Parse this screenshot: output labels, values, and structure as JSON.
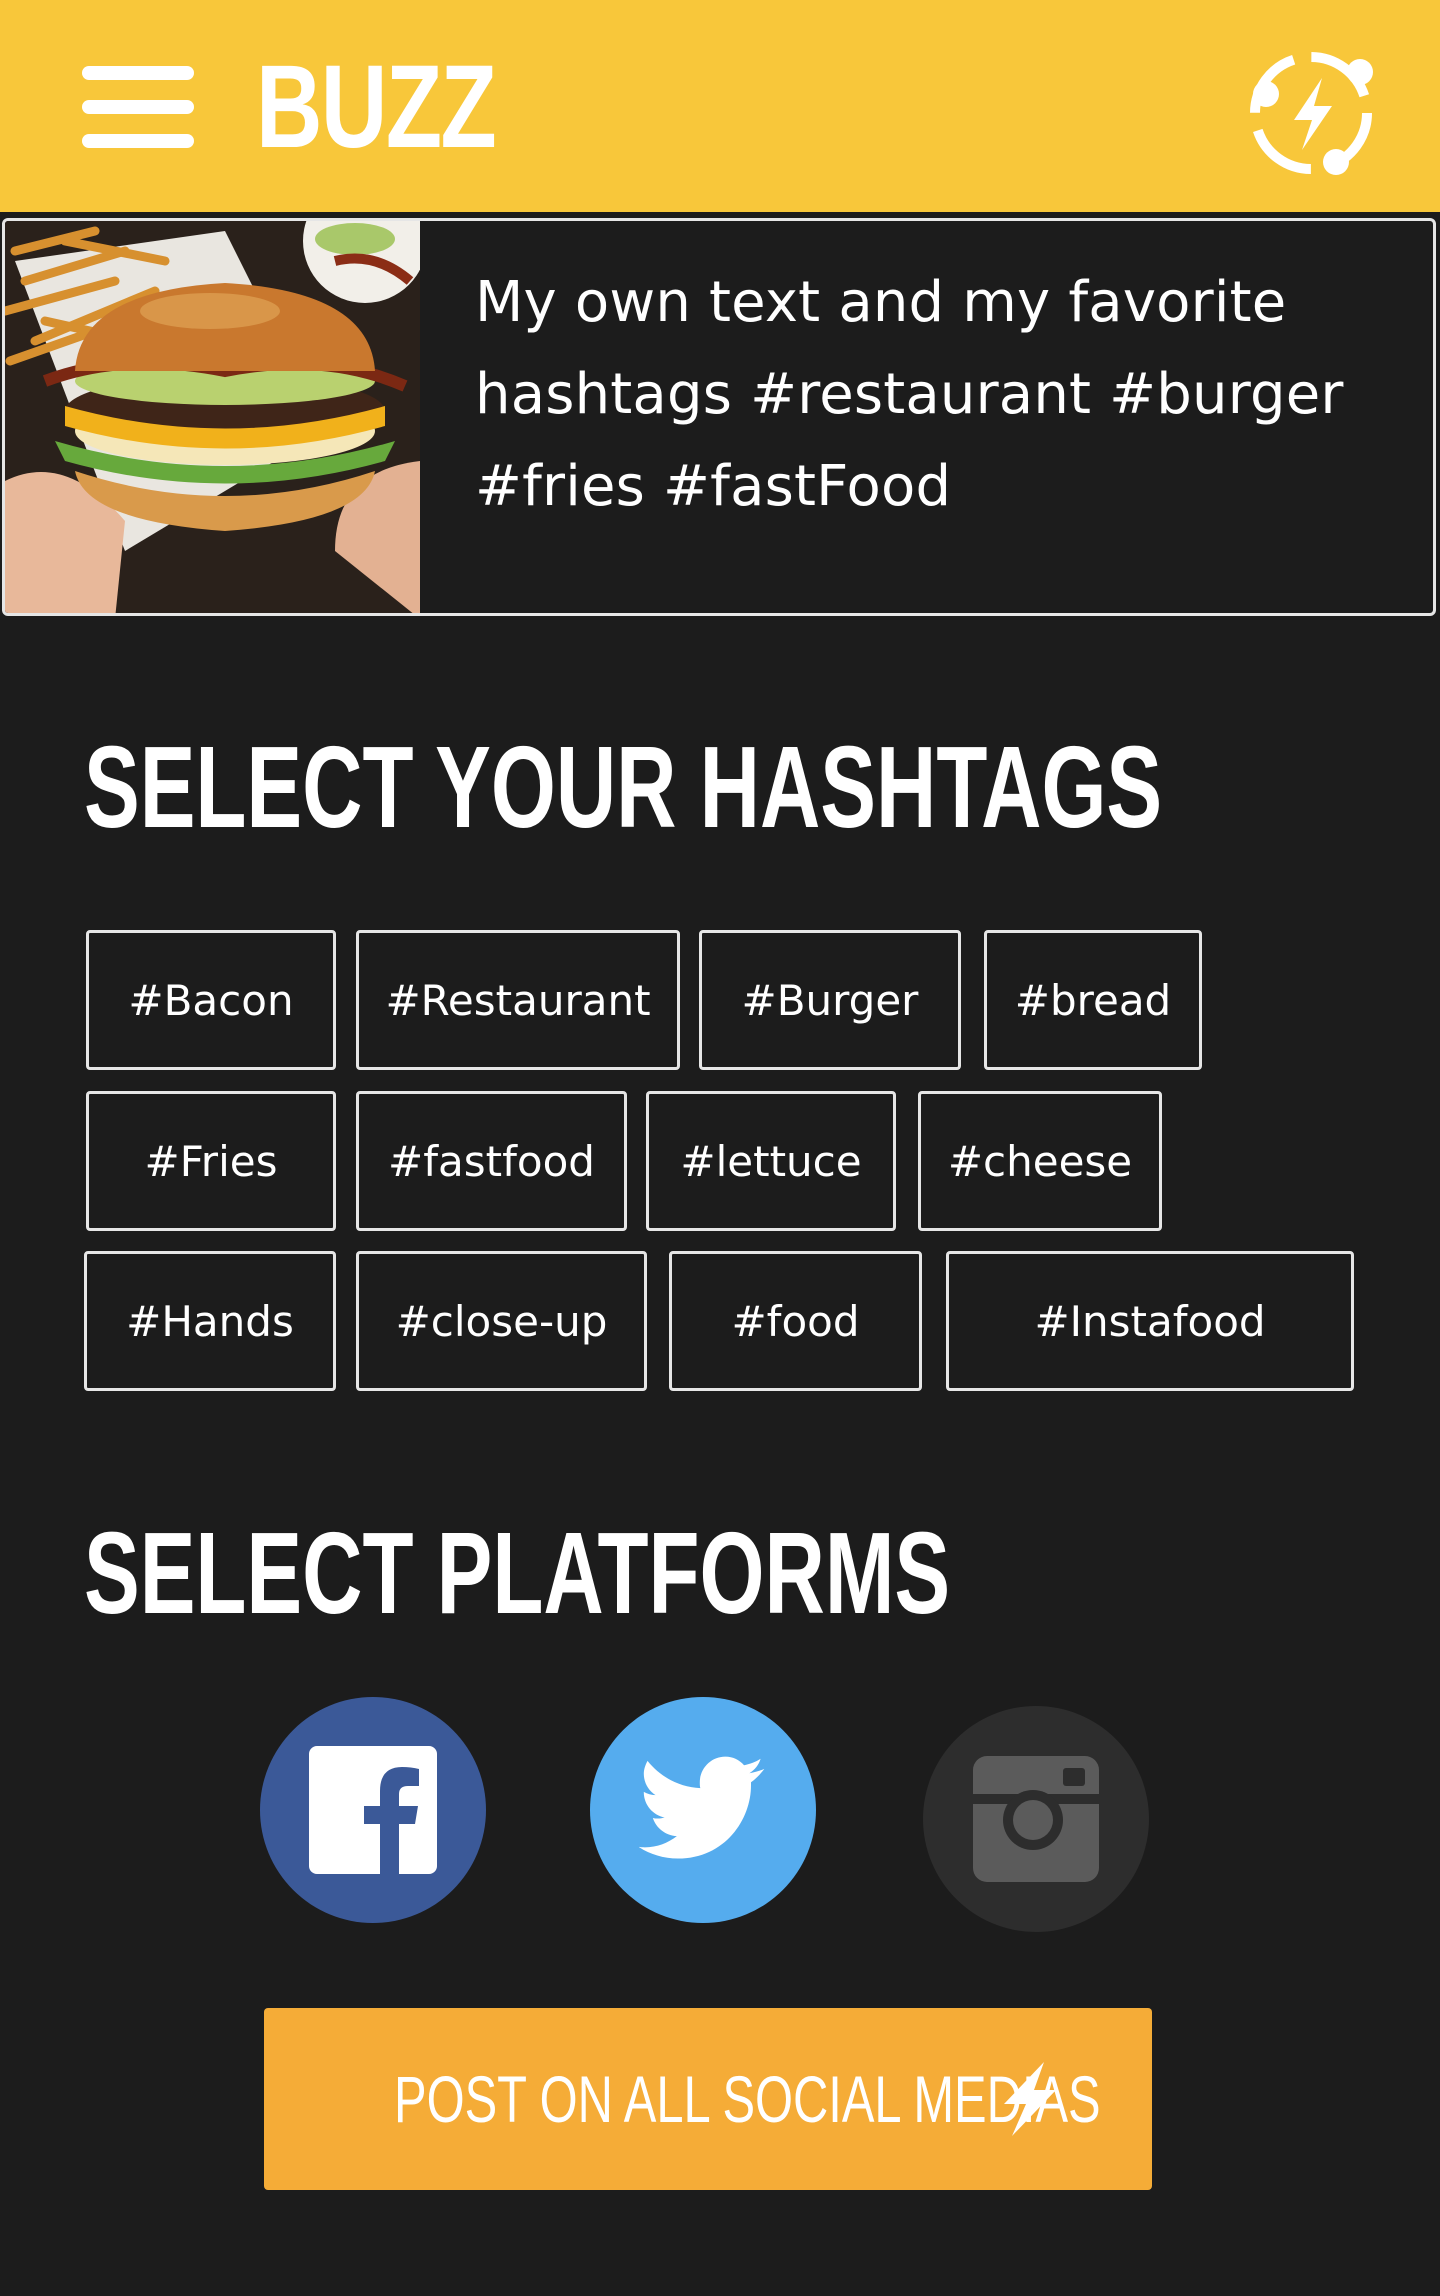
{
  "header": {
    "logo": "BUZZ",
    "menu_icon": "hamburger-menu-icon",
    "share_icon": "lightning-share-icon",
    "colors": {
      "background": "#f8c73a",
      "foreground": "#ffffff"
    }
  },
  "preview": {
    "image": "burger-photo",
    "text": "My own text and my favorite hashtags #restaurant #burger #fries #fastFood"
  },
  "hashtags": {
    "title": "SELECT YOUR HASHTAGS",
    "items": [
      "#Bacon",
      "#Restaurant",
      "#Burger",
      "#bread",
      "#Fries",
      "#fastfood",
      "#lettuce",
      "#cheese",
      "#Hands",
      "#close-up",
      "#food",
      "#Instafood"
    ]
  },
  "platforms": {
    "title": "SELECT PLATFORMS",
    "items": [
      {
        "name": "Facebook",
        "icon": "facebook-icon",
        "color": "#3b5998",
        "selected": true
      },
      {
        "name": "Twitter",
        "icon": "twitter-icon",
        "color": "#55acee",
        "selected": true
      },
      {
        "name": "Instagram",
        "icon": "instagram-icon",
        "color": "#2d2d2d",
        "selected": false
      }
    ]
  },
  "post_button": {
    "label": "POST ON ALL SOCIAL MEDIAS",
    "icon": "lightning-bolt-icon",
    "color": "#f5ac37"
  },
  "colors": {
    "background": "#1c1c1c",
    "accent_yellow": "#f8c73a",
    "accent_orange": "#f5ac37",
    "chip_border": "#e6e6e6"
  }
}
